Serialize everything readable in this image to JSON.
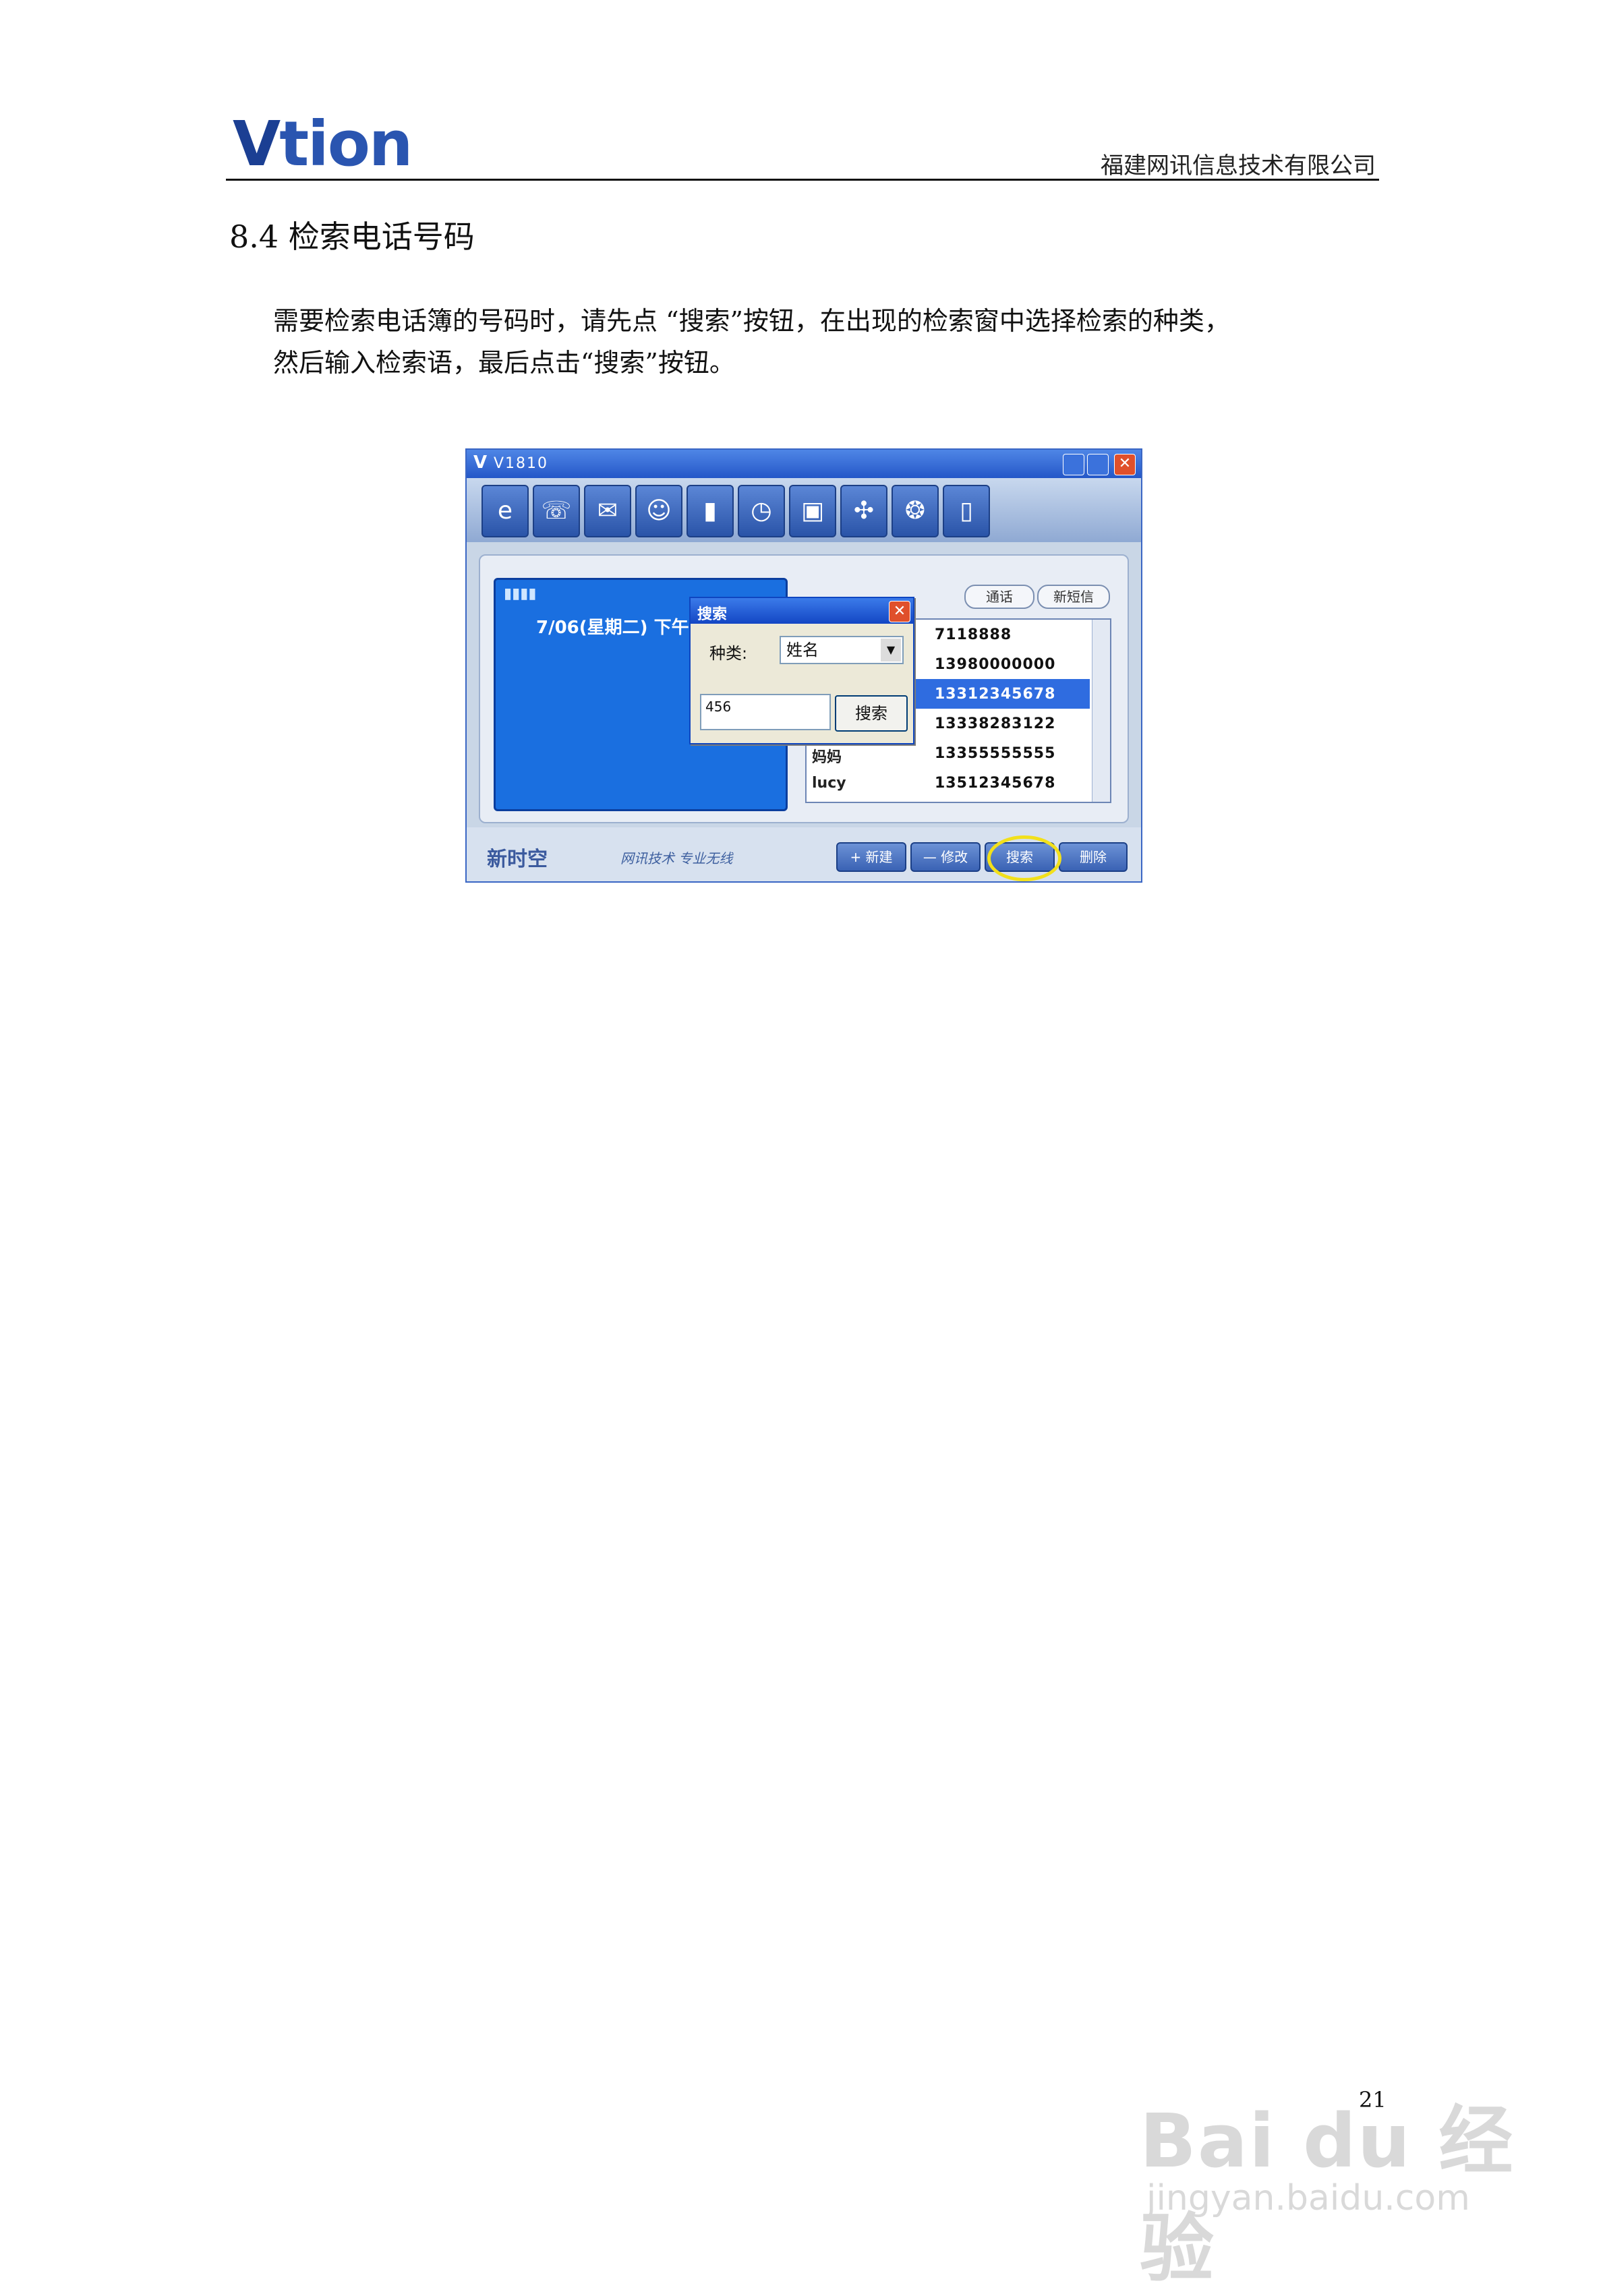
{
  "header": {
    "logo": "Vtion",
    "company": "福建网讯信息技术有限公司"
  },
  "section": {
    "title": "8.4 检索电话号码"
  },
  "body": {
    "para_line1": "需要检索电话簿的号码时，请先点 “搜索”按钮，在出现的检索窗中选择检索的种类，",
    "para_line2": "然后输入检索语，最后点击“搜索”按钮。"
  },
  "screenshot": {
    "window_title": "V1810",
    "toolbar_icons": [
      "ie-icon",
      "phone-icon",
      "mail-icon",
      "contacts-icon",
      "book-icon",
      "clock-icon",
      "gift-icon",
      "unicom-icon",
      "chat-icon",
      "door-icon"
    ],
    "status_date": "7/06(星期二) 下午",
    "call_label": "通话",
    "sms_label": "新短信",
    "contacts": [
      {
        "name": "",
        "number": "7118888"
      },
      {
        "name": "",
        "number": "13980000000"
      },
      {
        "name": "",
        "number": "13312345678"
      },
      {
        "name": "",
        "number": "13338283122"
      },
      {
        "name": "妈妈",
        "number": "13355555555"
      },
      {
        "name": "lucy",
        "number": "13512345678"
      }
    ],
    "dialog": {
      "title": "搜索",
      "type_label": "种类:",
      "type_value": "姓名",
      "query_value": "456",
      "search_button": "搜索"
    },
    "footer": {
      "brand": "新时空",
      "slogan": "网讯技术 专业无线",
      "new_button": "+ 新建",
      "edit_button": "— 修改",
      "search_button": "搜索",
      "delete_button": "删除"
    }
  },
  "page_number": "21",
  "watermark": {
    "main": "Bai du 经验",
    "sub": "jingyan.baidu.com"
  }
}
